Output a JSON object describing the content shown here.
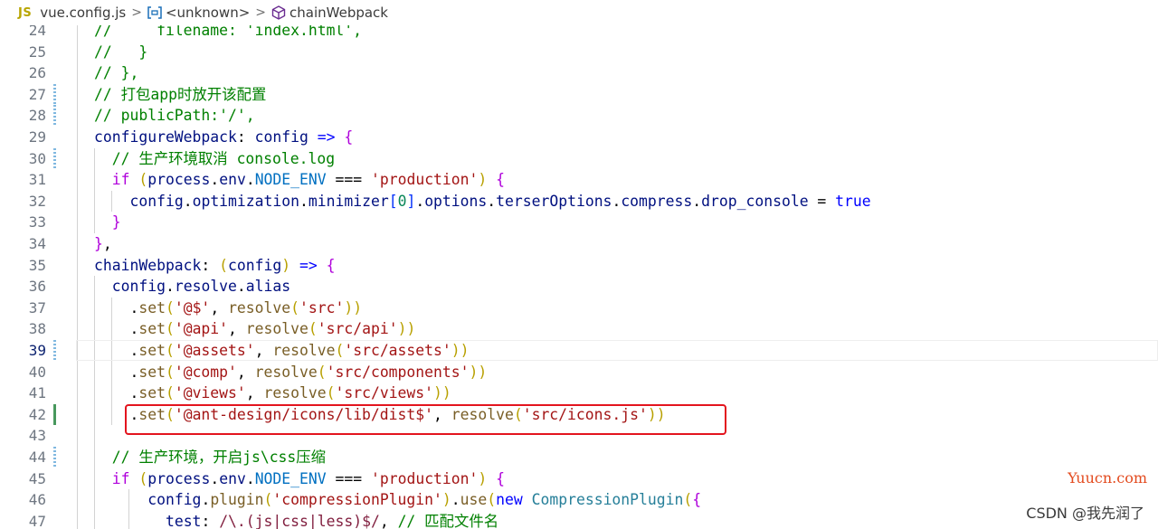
{
  "breadcrumb": {
    "lang_badge": "JS",
    "file": "vue.config.js",
    "sep": ">",
    "module": "<unknown>",
    "symbol": "chainWebpack"
  },
  "editor": {
    "current_line": 39,
    "lines": [
      {
        "n": 24,
        "t": "  //     filename: 'index.html',"
      },
      {
        "n": 25,
        "t": "  //   }"
      },
      {
        "n": 26,
        "t": "  // },"
      },
      {
        "n": 27,
        "t": "  // 打包app时放开该配置"
      },
      {
        "n": 28,
        "t": "  // publicPath:'/',"
      },
      {
        "n": 29,
        "t": "  configureWebpack: config => {"
      },
      {
        "n": 30,
        "t": "    // 生产环境取消 console.log"
      },
      {
        "n": 31,
        "t": "    if (process.env.NODE_ENV === 'production') {"
      },
      {
        "n": 32,
        "t": "      config.optimization.minimizer[0].options.terserOptions.compress.drop_console = true"
      },
      {
        "n": 33,
        "t": "    }"
      },
      {
        "n": 34,
        "t": "  },"
      },
      {
        "n": 35,
        "t": "  chainWebpack: (config) => {"
      },
      {
        "n": 36,
        "t": "    config.resolve.alias"
      },
      {
        "n": 37,
        "t": "      .set('@$', resolve('src'))"
      },
      {
        "n": 38,
        "t": "      .set('@api', resolve('src/api'))"
      },
      {
        "n": 39,
        "t": "      .set('@assets', resolve('src/assets'))"
      },
      {
        "n": 40,
        "t": "      .set('@comp', resolve('src/components'))"
      },
      {
        "n": 41,
        "t": "      .set('@views', resolve('src/views'))"
      },
      {
        "n": 42,
        "t": "      .set('@ant-design/icons/lib/dist$', resolve('src/icons.js'))"
      },
      {
        "n": 43,
        "t": ""
      },
      {
        "n": 44,
        "t": "    // 生产环境，开启js\\css压缩"
      },
      {
        "n": 45,
        "t": "    if (process.env.NODE_ENV === 'production') {"
      },
      {
        "n": 46,
        "t": "        config.plugin('compressionPlugin').use(new CompressionPlugin({"
      },
      {
        "n": 47,
        "t": "          test: /\\.(js|css|less)$/, // 匹配文件名"
      }
    ]
  },
  "watermarks": {
    "site": "Yuucn.com",
    "author": "CSDN @我先润了"
  },
  "colors": {
    "comment": "#008000",
    "keyword": "#0000ff",
    "control": "#af00db",
    "string": "#a31515",
    "number": "#098658",
    "variable": "#001080",
    "property": "#0070c1",
    "function": "#795e26",
    "highlight_box": "#e3141e"
  }
}
